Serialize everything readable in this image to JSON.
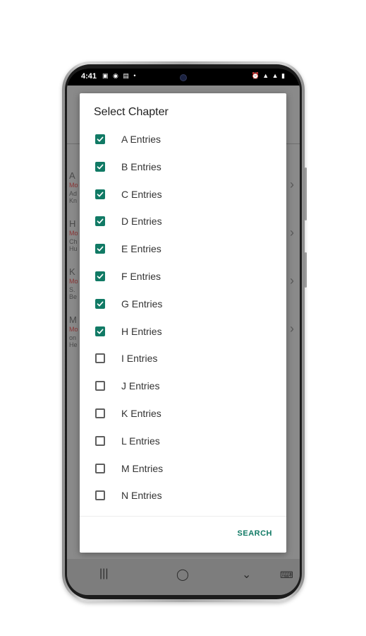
{
  "status_bar": {
    "time": "4:41",
    "left_icons": "▣ ◉ ▤ •",
    "right_icons": "⏰ ▲ ▲ ▮"
  },
  "background_app": {
    "items": [
      {
        "letter": "A",
        "sub": "Mo",
        "line1": "Ad",
        "line2": "Kn"
      },
      {
        "letter": "H",
        "sub": "Mo",
        "line1": "Ch",
        "line2": "Hu"
      },
      {
        "letter": "K",
        "sub": "Mo",
        "line1": "S.",
        "line2": "Be"
      },
      {
        "letter": "M",
        "sub": "Mo",
        "line1": "on",
        "line2": "He"
      }
    ]
  },
  "dialog": {
    "title": "Select Chapter",
    "options": [
      {
        "label": "A Entries",
        "checked": true
      },
      {
        "label": "B Entries",
        "checked": true
      },
      {
        "label": "C Entries",
        "checked": true
      },
      {
        "label": "D Entries",
        "checked": true
      },
      {
        "label": "E Entries",
        "checked": true
      },
      {
        "label": "F Entries",
        "checked": true
      },
      {
        "label": "G Entries",
        "checked": true
      },
      {
        "label": "H Entries",
        "checked": true
      },
      {
        "label": "I Entries",
        "checked": false
      },
      {
        "label": "J Entries",
        "checked": false
      },
      {
        "label": "K Entries",
        "checked": false
      },
      {
        "label": "L Entries",
        "checked": false
      },
      {
        "label": "M Entries",
        "checked": false
      },
      {
        "label": "N Entries",
        "checked": false
      }
    ],
    "search_label": "SEARCH"
  },
  "nav_bar": {
    "recents_icon": "|||",
    "home_icon": "◯",
    "back_icon": "⌄",
    "keyboard_icon": "⌨"
  },
  "colors": {
    "accent": "#117a65",
    "check_unselected": "#5f5f5f"
  }
}
